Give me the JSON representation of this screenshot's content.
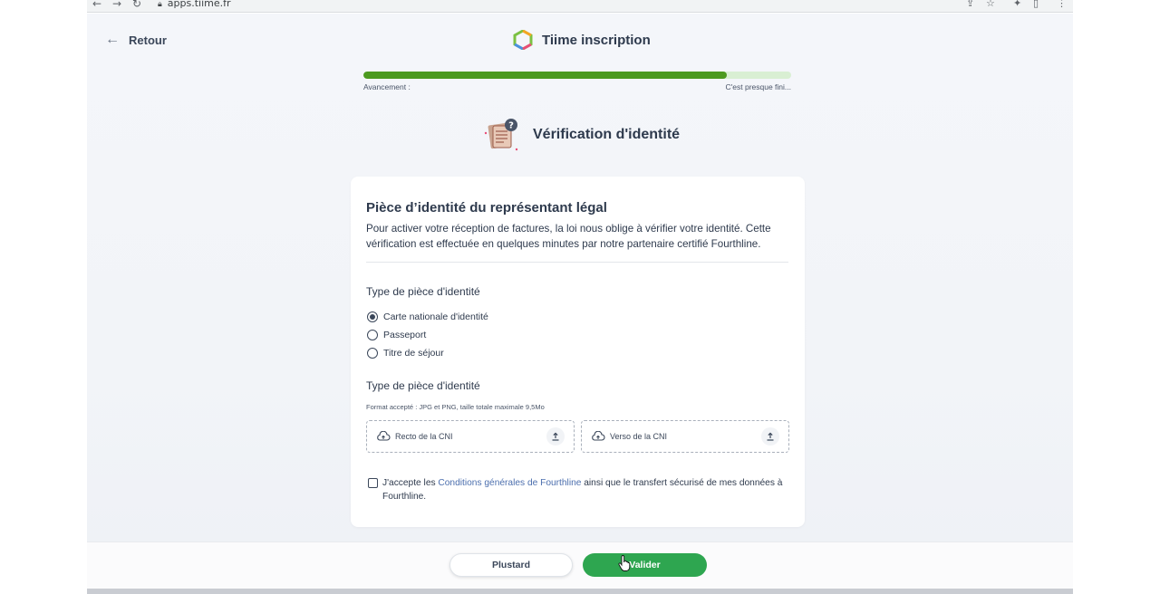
{
  "browser": {
    "back": "←",
    "forward": "→",
    "reload": "↻",
    "url": "apps.tiime.fr"
  },
  "header": {
    "back_label": "Retour",
    "app_title": "Tiime inscription"
  },
  "progress": {
    "left_label": "Avancement :",
    "right_label": "C'est presque fini...",
    "value_percent": 85
  },
  "section": {
    "title": "Vérification d'identité"
  },
  "card": {
    "heading": "Pièce d’identité du représentant légal",
    "intro": "Pour activer votre réception de factures, la loi nous oblige à vérifier votre identité. Cette vérification est effectuée en quelques minutes par notre partenaire certifié Fourthline.",
    "doc_type_label": "Type de pièce d'identité",
    "options": [
      {
        "label": "Carte nationale d'identité",
        "selected": true
      },
      {
        "label": "Passeport",
        "selected": false
      },
      {
        "label": "Titre de séjour",
        "selected": false
      }
    ],
    "upload_label": "Type de pièce d'identité",
    "format_hint": "Format accepté : JPG et PNG, taille totale maximale 9,5Mo",
    "uploads": [
      {
        "label": "Recto de la CNI"
      },
      {
        "label": "Verso de la CNI"
      }
    ],
    "terms": {
      "prefix": "J'accepte les ",
      "link": "Conditions générales de Fourthline",
      "suffix": " ainsi que le transfert sécurisé de mes données à Fourthline.",
      "checked": false
    }
  },
  "footer": {
    "later_label": "Plustard",
    "submit_label": "Valider"
  },
  "colors": {
    "progress_fill": "#4d9a1f",
    "progress_track": "#d9efd3",
    "primary_button": "#2ea650",
    "link": "#4c6fae"
  }
}
